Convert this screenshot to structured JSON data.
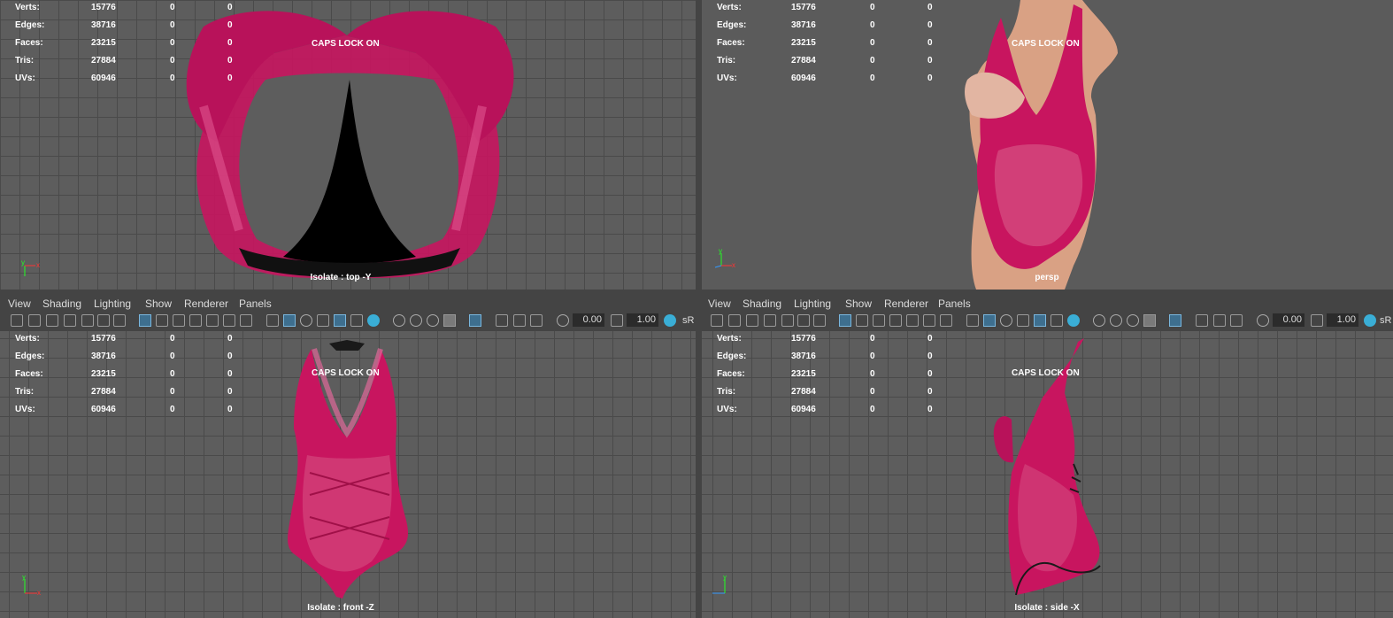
{
  "stats": {
    "rows": [
      {
        "label": "Verts:",
        "count": "15776",
        "a": "0",
        "b": "0"
      },
      {
        "label": "Edges:",
        "count": "38716",
        "a": "0",
        "b": "0"
      },
      {
        "label": "Faces:",
        "count": "23215",
        "a": "0",
        "b": "0"
      },
      {
        "label": "Tris:",
        "count": "27884",
        "a": "0",
        "b": "0"
      },
      {
        "label": "UVs:",
        "count": "60946",
        "a": "0",
        "b": "0"
      }
    ]
  },
  "caps_lock": "CAPS LOCK ON",
  "viewports": {
    "top": {
      "label": "Isolate : top -Y"
    },
    "persp": {
      "label": "persp"
    },
    "front": {
      "label": "Isolate : front -Z"
    },
    "side": {
      "label": "Isolate : side -X"
    }
  },
  "menu": {
    "view": "View",
    "shading": "Shading",
    "lighting": "Lighting",
    "show": "Show",
    "renderer": "Renderer",
    "panels": "Panels"
  },
  "toolbar": {
    "field1": "0.00",
    "field2": "1.00",
    "sr": "sR"
  },
  "colors": {
    "garment": "#c8155f",
    "lace": "#d44a7e",
    "skin": "#d9a184",
    "grid": "#4a4a4a",
    "bg": "#5d5d5d"
  }
}
